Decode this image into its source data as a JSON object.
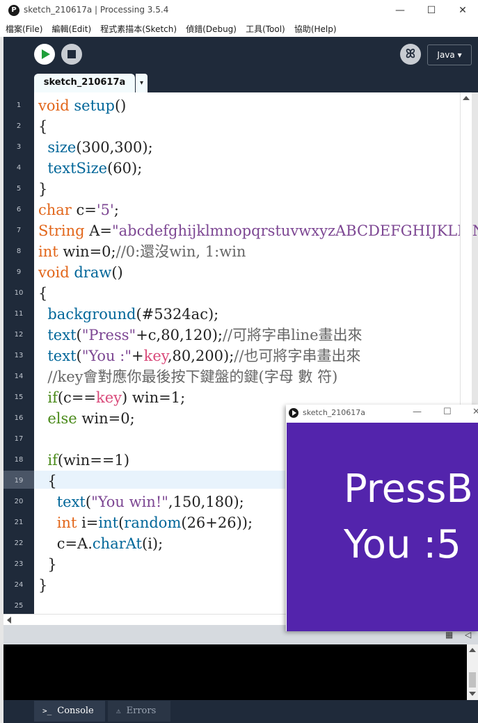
{
  "window": {
    "title": "sketch_210617a | Processing 3.5.4",
    "minimize": "—",
    "maximize": "☐",
    "close": "✕"
  },
  "menu": [
    "檔案(File)",
    "編輯(Edit)",
    "程式素描本(Sketch)",
    "偵錯(Debug)",
    "工具(Tool)",
    "協助(Help)"
  ],
  "toolbar": {
    "mode": "Java ▾",
    "debug_glyph": "ꕤ"
  },
  "tab": {
    "label": "sketch_210617a",
    "arrow": "▾"
  },
  "code": {
    "line_numbers": [
      "1",
      "2",
      "3",
      "4",
      "5",
      "6",
      "7",
      "8",
      "9",
      "10",
      "11",
      "12",
      "13",
      "14",
      "15",
      "16",
      "17",
      "18",
      "19",
      "20",
      "21",
      "22",
      "23",
      "24",
      "25"
    ],
    "lines": [
      [
        {
          "t": "void",
          "c": "kw"
        },
        {
          "t": " "
        },
        {
          "t": "setup",
          "c": "fn"
        },
        {
          "t": "()"
        }
      ],
      [
        {
          "t": "{"
        }
      ],
      [
        {
          "t": "  "
        },
        {
          "t": "size",
          "c": "fn"
        },
        {
          "t": "(300,300);"
        }
      ],
      [
        {
          "t": "  "
        },
        {
          "t": "textSize",
          "c": "fn"
        },
        {
          "t": "(60);"
        }
      ],
      [
        {
          "t": "}"
        }
      ],
      [
        {
          "t": "char",
          "c": "kw"
        },
        {
          "t": " c="
        },
        {
          "t": "'5'",
          "c": "str"
        },
        {
          "t": ";"
        }
      ],
      [
        {
          "t": "String",
          "c": "kw"
        },
        {
          "t": " A="
        },
        {
          "t": "\"abcdefghijklmnopqrstuvwxyzABCDEFGHIJKLMN(",
          "c": "str"
        }
      ],
      [
        {
          "t": "int",
          "c": "kw"
        },
        {
          "t": " win=0;"
        },
        {
          "t": "//0:還沒win, 1:win",
          "c": "cm"
        }
      ],
      [
        {
          "t": "void",
          "c": "kw"
        },
        {
          "t": " "
        },
        {
          "t": "draw",
          "c": "fn"
        },
        {
          "t": "()"
        }
      ],
      [
        {
          "t": "{"
        }
      ],
      [
        {
          "t": "  "
        },
        {
          "t": "background",
          "c": "fn"
        },
        {
          "t": "(#5324ac);"
        }
      ],
      [
        {
          "t": "  "
        },
        {
          "t": "text",
          "c": "fn"
        },
        {
          "t": "("
        },
        {
          "t": "\"Press\"",
          "c": "str"
        },
        {
          "t": "+c,80,120);"
        },
        {
          "t": "//可將字串line畫出來",
          "c": "cm"
        }
      ],
      [
        {
          "t": "  "
        },
        {
          "t": "text",
          "c": "fn"
        },
        {
          "t": "("
        },
        {
          "t": "\"You :\"",
          "c": "str"
        },
        {
          "t": "+"
        },
        {
          "t": "key",
          "c": "ky"
        },
        {
          "t": ",80,200);"
        },
        {
          "t": "//也可將字串畫出來",
          "c": "cm"
        }
      ],
      [
        {
          "t": "  "
        },
        {
          "t": "//key會對應你最後按下鍵盤的鍵(字母 數 符)",
          "c": "cm"
        }
      ],
      [
        {
          "t": "  "
        },
        {
          "t": "if",
          "c": "fn2"
        },
        {
          "t": "(c=="
        },
        {
          "t": "key",
          "c": "ky"
        },
        {
          "t": ") win=1;"
        }
      ],
      [
        {
          "t": "  "
        },
        {
          "t": "else",
          "c": "fn2"
        },
        {
          "t": " win=0;"
        }
      ],
      [
        {
          "t": ""
        }
      ],
      [
        {
          "t": "  "
        },
        {
          "t": "if",
          "c": "fn2"
        },
        {
          "t": "(win==1)"
        }
      ],
      [
        {
          "t": "  {"
        }
      ],
      [
        {
          "t": "    "
        },
        {
          "t": "text",
          "c": "fn"
        },
        {
          "t": "("
        },
        {
          "t": "\"You win!\"",
          "c": "str"
        },
        {
          "t": ",150,180);"
        }
      ],
      [
        {
          "t": "    "
        },
        {
          "t": "int",
          "c": "kw"
        },
        {
          "t": " i="
        },
        {
          "t": "int",
          "c": "fn"
        },
        {
          "t": "("
        },
        {
          "t": "random",
          "c": "fn"
        },
        {
          "t": "(26+26));"
        }
      ],
      [
        {
          "t": "    c=A."
        },
        {
          "t": "charAt",
          "c": "fn"
        },
        {
          "t": "(i);"
        }
      ],
      [
        {
          "t": "  }"
        }
      ],
      [
        {
          "t": "}"
        }
      ],
      [
        {
          "t": ""
        }
      ]
    ]
  },
  "bottom_tabs": {
    "console": "Console",
    "errors": "Errors"
  },
  "sketch_window": {
    "title": "sketch_210617a",
    "minimize": "—",
    "maximize": "☐",
    "close": "✕",
    "background": "#5324ac",
    "text_lines": [
      "PressB",
      "You :5"
    ]
  },
  "colors": {
    "frame": "#1f2a3a",
    "keyword": "#e2661a",
    "function": "#006699",
    "string": "#7d4793",
    "comment": "#666666"
  }
}
